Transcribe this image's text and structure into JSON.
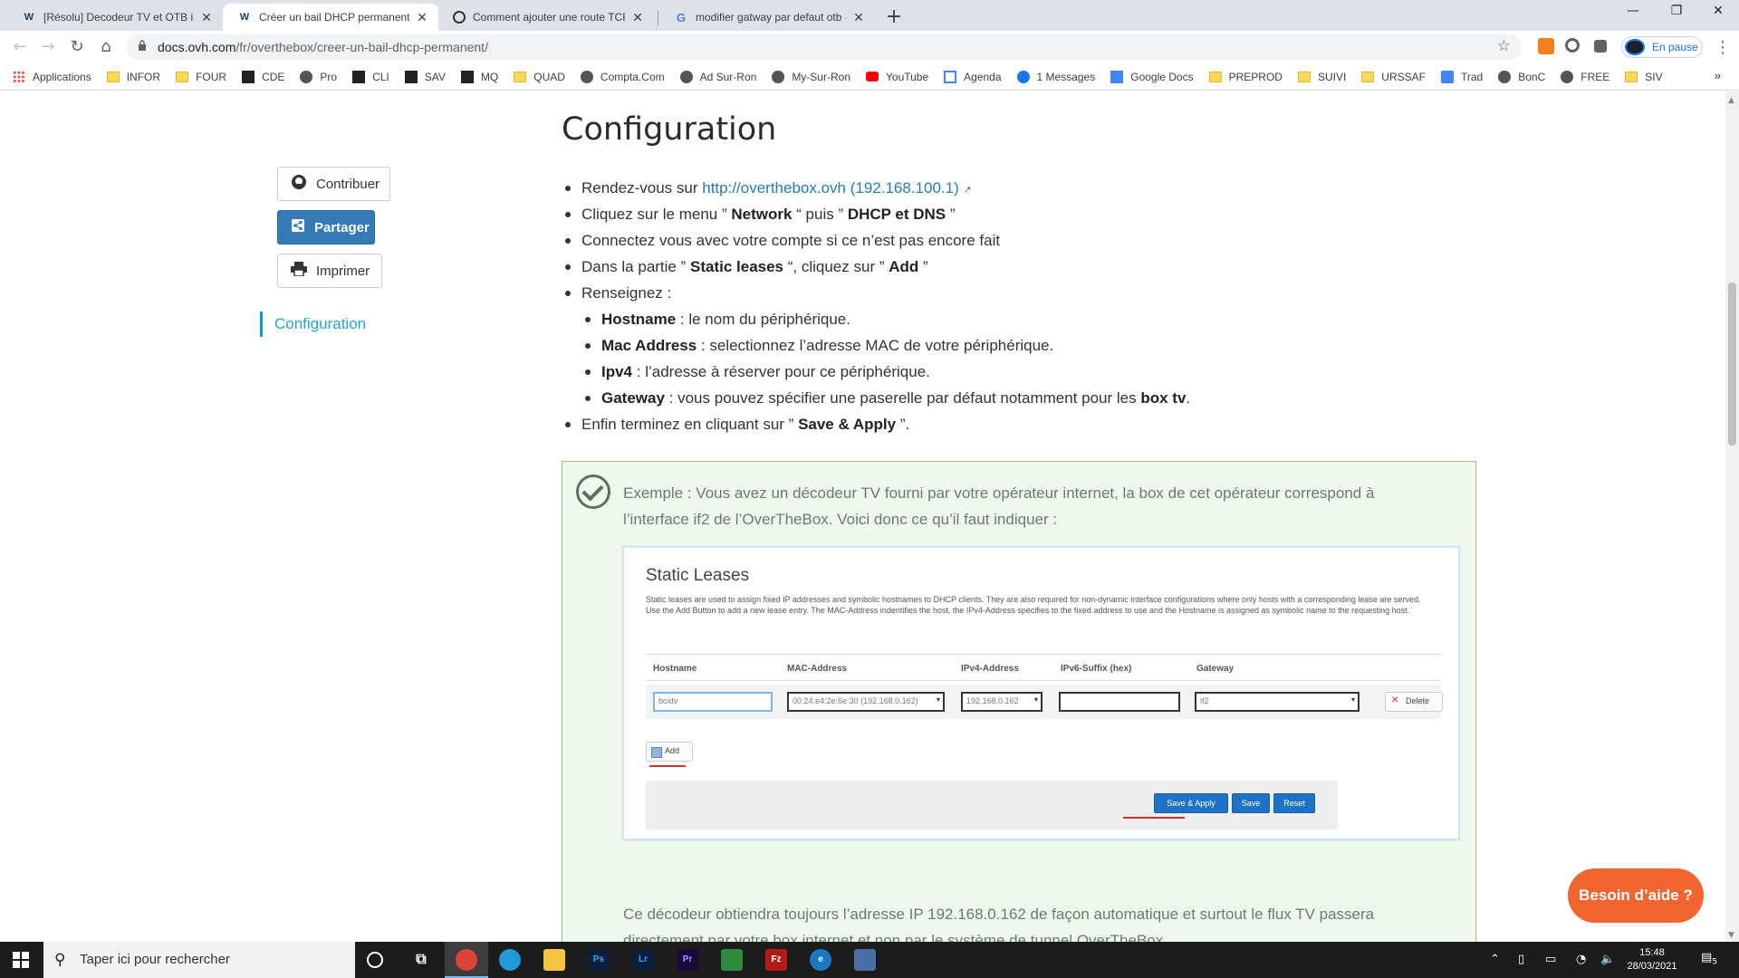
{
  "browser": {
    "tabs": [
      {
        "title": "[Résolu] Decodeur TV et OTB inc",
        "icon": "ovh-icon",
        "active": false
      },
      {
        "title": "Créer un bail DHCP permanent /",
        "icon": "ovh-icon",
        "active": true
      },
      {
        "title": "Comment ajouter une route TCP",
        "icon": "web-icon",
        "active": false
      },
      {
        "title": "modifier gatway par defaut otb -",
        "icon": "google-icon",
        "active": false
      }
    ],
    "url_host": "docs.ovh.com",
    "url_path": "/fr/overthebox/creer-un-bail-dhcp-permanent/",
    "profile_label": "En pause",
    "bookmarks": [
      {
        "label": "Applications",
        "icon": "apps-grid-icon"
      },
      {
        "label": "INFOR",
        "icon": "folder-icon"
      },
      {
        "label": "FOUR",
        "icon": "folder-icon"
      },
      {
        "label": "CDE",
        "icon": "quad-icon"
      },
      {
        "label": "Pro",
        "icon": "site-icon"
      },
      {
        "label": "CLI",
        "icon": "quad-icon"
      },
      {
        "label": "SAV",
        "icon": "quad-icon"
      },
      {
        "label": "MQ",
        "icon": "quad-icon"
      },
      {
        "label": "QUAD",
        "icon": "folder-icon"
      },
      {
        "label": "Compta.Com",
        "icon": "site-icon"
      },
      {
        "label": "Ad Sur-Ron",
        "icon": "site-icon"
      },
      {
        "label": "My-Sur-Ron",
        "icon": "site-icon"
      },
      {
        "label": "YouTube",
        "icon": "youtube-icon"
      },
      {
        "label": "Agenda",
        "icon": "calendar-icon"
      },
      {
        "label": "1 Messages",
        "icon": "facebook-icon"
      },
      {
        "label": "Google Docs",
        "icon": "docs-icon"
      },
      {
        "label": "PREPROD",
        "icon": "folder-icon"
      },
      {
        "label": "SUIVI",
        "icon": "folder-icon"
      },
      {
        "label": "URSSAF",
        "icon": "folder-icon"
      },
      {
        "label": "Trad",
        "icon": "translate-icon"
      },
      {
        "label": "BonC",
        "icon": "site-icon"
      },
      {
        "label": "FREE",
        "icon": "site-icon"
      },
      {
        "label": "SIV",
        "icon": "folder-icon"
      }
    ],
    "bookmarks_more": "»"
  },
  "sidebar": {
    "contribute_label": "Contribuer",
    "share_label": "Partager",
    "print_label": "Imprimer",
    "toc_item": "Configuration"
  },
  "article": {
    "title": "Configuration",
    "steps": {
      "s1_pre": "Rendez-vous sur ",
      "s1_link": "http://overthebox.ovh (192.168.100.1)",
      "s2_a": "Cliquez sur le menu ” ",
      "s2_b": "Network",
      "s2_c": " “ puis ” ",
      "s2_d": "DHCP et DNS",
      "s2_e": " ”",
      "s3": "Connectez vous avec votre compte si ce n’est pas encore fait",
      "s4_a": "Dans la partie ” ",
      "s4_b": "Static leases",
      "s4_c": " “, cliquez sur ” ",
      "s4_d": "Add",
      "s4_e": " ”",
      "s5": "Renseignez :",
      "sub1_b": "Hostname",
      "sub1_t": " : le nom du périphérique.",
      "sub2_b": "Mac Address",
      "sub2_t": " : selectionnez l’adresse MAC de votre périphérique.",
      "sub3_b": "Ipv4",
      "sub3_t": " : l’adresse à réserver pour ce périphérique.",
      "sub4_b": "Gateway",
      "sub4_t": " : vous pouvez spécifier une paserelle par défaut notamment pour les ",
      "sub4_b2": "box tv",
      "sub4_e": ".",
      "s6_a": "Enfin terminez en cliquant sur ” ",
      "s6_b": "Save & Apply",
      "s6_c": " ”."
    },
    "note_text": "Exemple : Vous avez un décodeur TV fourni par votre opérateur internet, la box de cet opérateur correspond à l’interface if2 de l’OverTheBox. Voici donc ce qu’il faut indiquer :",
    "note_bottom": "Ce décodeur obtiendra toujours l’adresse IP 192.168.0.162 de façon automatique et surtout le flux TV passera directement par votre box internet et non par le système de tunnel OverTheBox."
  },
  "screenshot": {
    "title": "Static Leases",
    "desc1": "Static leases are used to assign fixed IP addresses and symbolic hostnames to DHCP clients. They are also required for non-dynamic interface configurations where only hosts with a corresponding lease are served.",
    "desc2": "Use the Add Button to add a new lease entry. The MAC-Address indentifies the host, the IPv4-Address specifies to the fixed address to use and the Hostname is assigned as symbolic name to the requesting host.",
    "col_hostname": "Hostname",
    "col_mac": "MAC-Address",
    "col_ipv4": "IPv4-Address",
    "col_ipv6": "IPv6-Suffix (hex)",
    "col_gateway": "Gateway",
    "hostname_value": "boxtv",
    "mac_value": "00:24:e4:2e:6e:30 (192.168.0.162)",
    "ipv4_value": "192.168.0.162",
    "ipv6_value": "",
    "gateway_value": "if2",
    "delete_label": "Delete",
    "add_label": "Add",
    "save_apply_label": "Save & Apply",
    "save_label": "Save",
    "reset_label": "Reset"
  },
  "help_button": "Besoin d’aide ?",
  "taskbar": {
    "search_placeholder": "Taper ici pour rechercher",
    "time": "15:48",
    "date": "28/03/2021",
    "notif_count": "5"
  }
}
